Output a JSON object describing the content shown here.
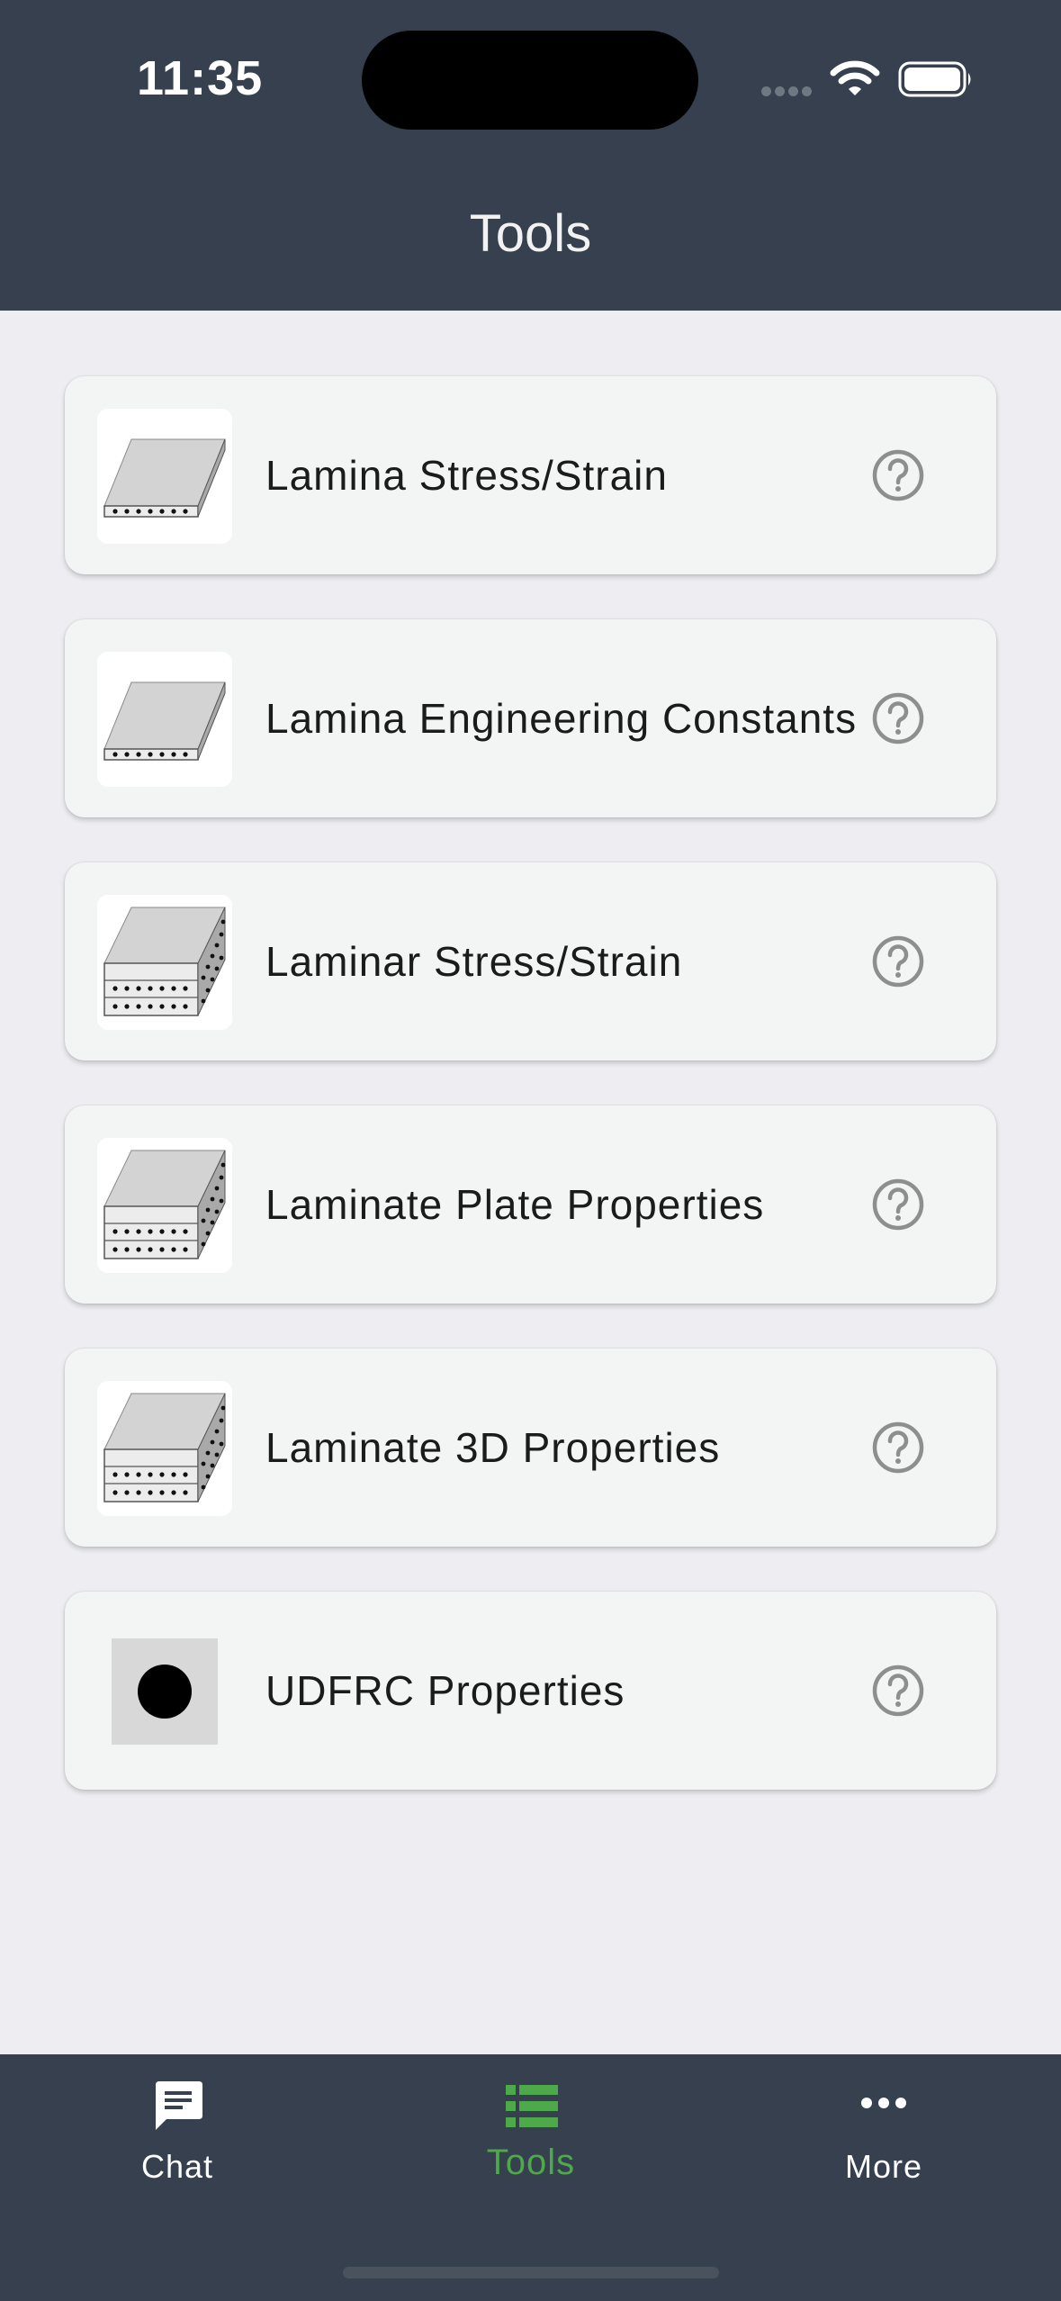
{
  "status_bar": {
    "time": "11:35"
  },
  "header": {
    "title": "Tools"
  },
  "tools": [
    {
      "label": "Lamina Stress/Strain",
      "icon": "single-layer-lamina-icon"
    },
    {
      "label": "Lamina Engineering Constants",
      "icon": "single-layer-lamina-icon"
    },
    {
      "label": "Laminar Stress/Strain",
      "icon": "stacked-laminate-icon"
    },
    {
      "label": "Laminate Plate Properties",
      "icon": "stacked-laminate-icon"
    },
    {
      "label": "Laminate 3D Properties",
      "icon": "stacked-laminate-icon"
    },
    {
      "label": "UDFRC Properties",
      "icon": "fiber-cross-section-icon"
    }
  ],
  "tabbar": {
    "tabs": [
      {
        "label": "Chat",
        "icon": "chat-icon",
        "active": false
      },
      {
        "label": "Tools",
        "icon": "list-icon",
        "active": true
      },
      {
        "label": "More",
        "icon": "more-dots-icon",
        "active": false
      }
    ]
  },
  "colors": {
    "header_bg": "#36404e",
    "page_bg": "#eeeef2",
    "card_bg": "#f3f4f4",
    "active_tab": "#4ea94a",
    "tab_label": "#ffffff"
  }
}
